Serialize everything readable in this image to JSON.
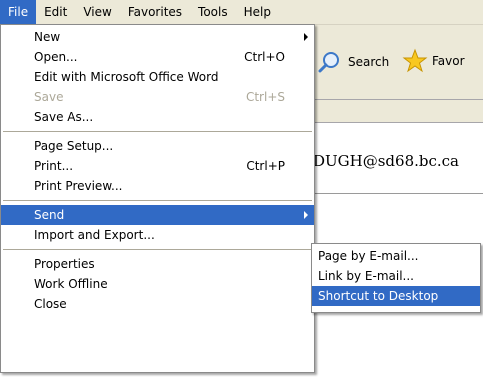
{
  "menubar": {
    "items": [
      "File",
      "Edit",
      "View",
      "Favorites",
      "Tools",
      "Help"
    ],
    "active": "File"
  },
  "toolbar": {
    "search_label": "Search",
    "favorites_label": "Favor"
  },
  "content": {
    "email_text": "DUGH@sd68.bc.ca"
  },
  "file_menu": {
    "new": "New",
    "open": "Open...",
    "open_shortcut": "Ctrl+O",
    "edit_with_word": "Edit with Microsoft Office Word",
    "save": "Save",
    "save_shortcut": "Ctrl+S",
    "save_as": "Save As...",
    "page_setup": "Page Setup...",
    "print": "Print...",
    "print_shortcut": "Ctrl+P",
    "print_preview": "Print Preview...",
    "send": "Send",
    "import_export": "Import and Export...",
    "properties": "Properties",
    "work_offline": "Work Offline",
    "close": "Close"
  },
  "send_submenu": {
    "page_by_email": "Page by E-mail...",
    "link_by_email": "Link by E-mail...",
    "shortcut_to_desktop": "Shortcut to Desktop"
  },
  "colors": {
    "highlight": "#316ac5",
    "menu_bar": "#ece9d8",
    "disabled_text": "#aca899"
  },
  "icons": {
    "search": "search-magnifier-icon",
    "favorites": "favorites-star-icon"
  }
}
